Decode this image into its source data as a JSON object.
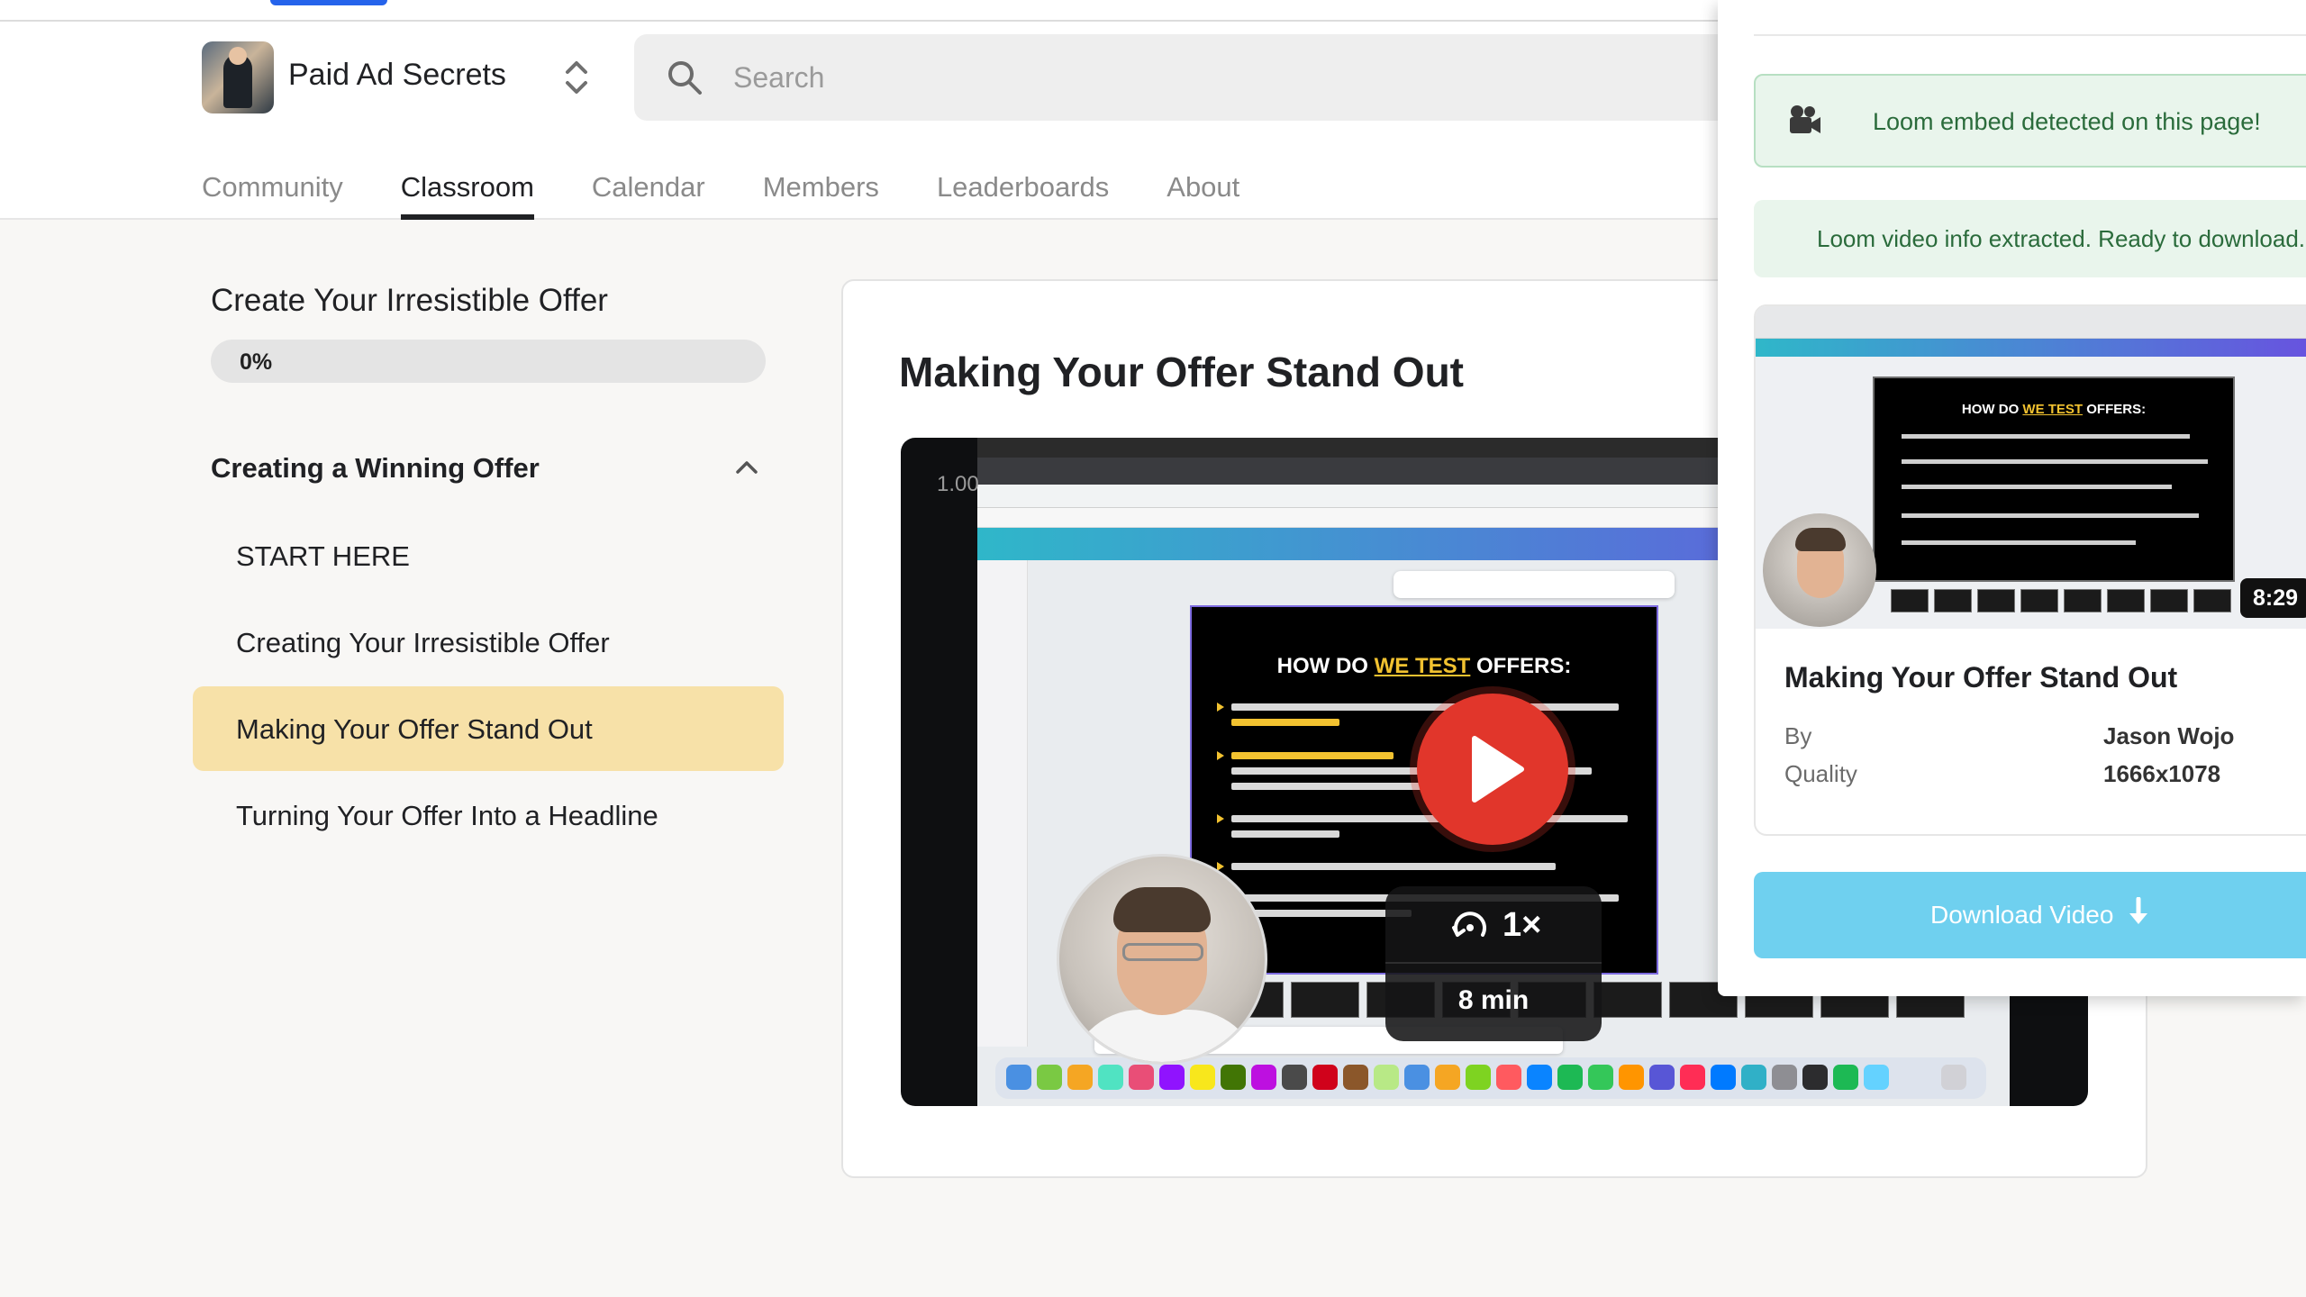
{
  "header": {
    "brand_name": "Paid Ad Secrets",
    "search_placeholder": "Search",
    "tabs": [
      {
        "label": "Community"
      },
      {
        "label": "Classroom"
      },
      {
        "label": "Calendar"
      },
      {
        "label": "Members"
      },
      {
        "label": "Leaderboards"
      },
      {
        "label": "About"
      }
    ],
    "active_tab": "Classroom"
  },
  "sidebar": {
    "course_title": "Create Your Irresistible Offer",
    "progress_label": "0%",
    "progress_fraction": 0,
    "module_title": "Creating a Winning Offer",
    "lessons": [
      {
        "label": "START HERE"
      },
      {
        "label": "Creating Your Irresistible Offer"
      },
      {
        "label": "Making Your Offer Stand Out"
      },
      {
        "label": "Turning Your Offer Into a Headline"
      }
    ],
    "active_lesson": "Making Your Offer Stand Out"
  },
  "main": {
    "lesson_title": "Making Your Offer Stand Out",
    "video": {
      "speed_overlay": "1.00",
      "slide_heading_pre": "HOW DO ",
      "slide_heading_highlight": "WE TEST",
      "slide_heading_post": " OFFERS:",
      "playback_rate": "1×",
      "length_label": "8 min"
    }
  },
  "extension": {
    "detected_message": "Loom embed detected on this page!",
    "ready_message": "Loom video info extracted. Ready to download.",
    "video_title": "Making Your Offer Stand Out",
    "duration": "8:29",
    "by_label": "By",
    "by_value": "Jason Wojo",
    "quality_label": "Quality",
    "quality_value": "1666x1078",
    "download_label": "Download Video"
  },
  "colors": {
    "accent_active_lesson": "#f7e1a8",
    "play_button": "#e1362b",
    "download_button": "#6fd0ef",
    "success_bg": "#e9f5ec",
    "success_text": "#2a6b3b",
    "slide_highlight": "#f2c230"
  },
  "icons": {
    "search": "search-icon",
    "switcher": "chevron-updown-icon",
    "collapse": "chevron-up-icon",
    "play": "play-icon",
    "speed": "speed-icon",
    "camera": "movie-camera-icon",
    "download": "download-arrow-icon"
  }
}
